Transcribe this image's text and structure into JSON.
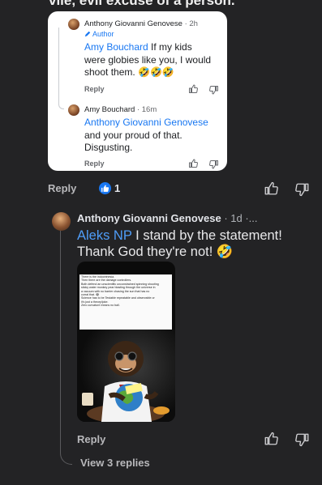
{
  "top_text": "vile, evil excuse of a person.",
  "reply_card": {
    "comment1": {
      "author": "Anthony Giovanni Genovese",
      "time": "· 2h",
      "badge": "Author",
      "tag": "Amy Bouchard",
      "text_line1": "If my kids",
      "text_line2": "were globies like you, I would",
      "text_line3": "shoot them. 🤣🤣🤣",
      "reply": "Reply"
    },
    "comment2": {
      "author": "Amy Bouchard",
      "time": "· 16m",
      "tag": "Anthony Giovanni Genovese",
      "text_line2": "and your proud of that.",
      "text_line3": "Disgusting.",
      "reply": "Reply"
    }
  },
  "parent_actions": {
    "reply": "Reply",
    "like_count": "1"
  },
  "main_comment": {
    "author": "Anthony Giovanni Genovese",
    "time": "· 1d ·...",
    "tag": "Aleks NP",
    "text_line1": "I stand by the statement!",
    "text_line2": "Thank God they're not! 🤣",
    "image_lines": [
      "There is the indoctrinesia.",
      "Then there are the damage controllers.",
      "Both defend an unscientific unconstrained spinning shooting",
      "sticky water monkey pear blasting through the universe in",
      "a vacuum with no barrier chasing the sun that has no",
      "corral that. 😂",
      "Science has to be Testable repeatable and observable or",
      "it's just a theory/joke.",
      "Zero curvature means no ball."
    ],
    "reply": "Reply",
    "view_replies": "View 3 replies"
  },
  "colors": {
    "background": "#232325",
    "accent": "#1877f2",
    "link_dark": "#4f9df8"
  },
  "icons": [
    "thumbs-up-icon",
    "thumbs-down-icon",
    "like-badge-icon",
    "pencil-icon"
  ]
}
